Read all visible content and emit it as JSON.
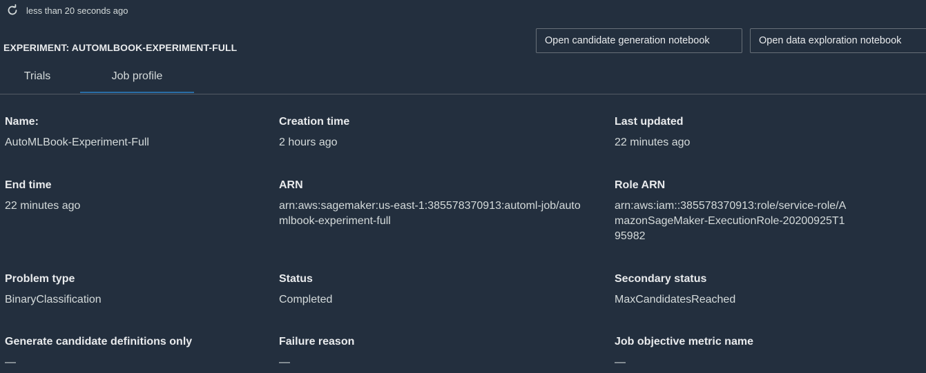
{
  "refresh": {
    "icon": "refresh-icon",
    "text": "less than 20 seconds ago"
  },
  "experiment_title": "EXPERIMENT: AUTOMLBOOK-EXPERIMENT-FULL",
  "buttons": {
    "candidate_notebook": "Open candidate generation notebook",
    "data_exploration_notebook": "Open data exploration notebook"
  },
  "tabs": [
    {
      "label": "Trials",
      "active": false
    },
    {
      "label": "Job profile",
      "active": true
    }
  ],
  "fields": {
    "name": {
      "label": "Name:",
      "value": "AutoMLBook-Experiment-Full"
    },
    "creation_time": {
      "label": "Creation time",
      "value": "2 hours ago"
    },
    "last_updated": {
      "label": "Last updated",
      "value": "22 minutes ago"
    },
    "end_time": {
      "label": "End time",
      "value": "22 minutes ago"
    },
    "arn": {
      "label": "ARN",
      "value": "arn:aws:sagemaker:us-east-1:385578370913:automl-job/automlbook-experiment-full"
    },
    "role_arn": {
      "label": "Role ARN",
      "value": "arn:aws:iam::385578370913:role/service-role/AmazonSageMaker-ExecutionRole-20200925T195982"
    },
    "problem_type": {
      "label": "Problem type",
      "value": "BinaryClassification"
    },
    "status": {
      "label": "Status",
      "value": "Completed"
    },
    "secondary_status": {
      "label": "Secondary status",
      "value": "MaxCandidatesReached"
    },
    "generate_candidates_only": {
      "label": "Generate candidate definitions only",
      "value": "—"
    },
    "failure_reason": {
      "label": "Failure reason",
      "value": "—"
    },
    "job_objective_metric": {
      "label": "Job objective metric name",
      "value": "—"
    }
  },
  "colors": {
    "background": "#232f3e",
    "tab_active_underline": "#2a6ea6",
    "border": "#687078"
  }
}
